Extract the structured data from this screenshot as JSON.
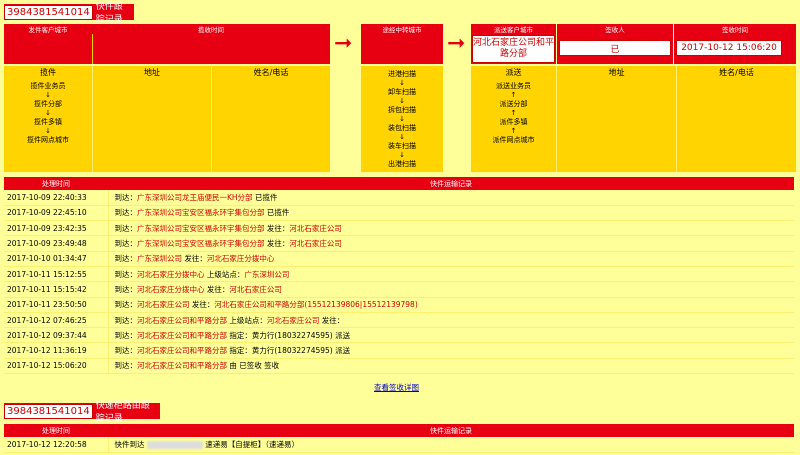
{
  "track": {
    "number": "3984381541014",
    "title": "快件跟踪记录",
    "col_origin_city": "发件客户城市",
    "col_collect_time": "揽收时间",
    "col_transit_city": "途经中转城市",
    "col_dest_city": "派送客户城市",
    "col_signer": "签收人",
    "col_sign_time": "签收时间",
    "dest_city_value": "河北石家庄公司和平路分部",
    "signer_value": "已",
    "sign_time_value": "2017-10-12 15:06:20",
    "sub_collect": "揽件",
    "sub_address": "地址",
    "sub_name_phone": "姓名/电话",
    "sub_deliver": "派送",
    "sub_address2": "地址",
    "sub_name_phone2": "姓名/电话",
    "collect_steps": [
      "揽件业务员",
      "揽件分部",
      "揽件多镇",
      "揽件网点城市"
    ],
    "transit_steps": [
      "进港扫描",
      "卸车扫描",
      "拆包扫描",
      "装包扫描",
      "装车扫描",
      "出港扫描"
    ],
    "deliver_steps": [
      "派送业务员",
      "派送分部",
      "派件多镇",
      "派件网点城市"
    ],
    "down_arrow": "↓",
    "up_arrow": "↑",
    "right_arrow": "➞"
  },
  "log": {
    "col_time": "处理时间",
    "col_record": "快件运输记录",
    "rows": [
      {
        "time": "2017-10-09 22:40:33",
        "pre": "到达：",
        "a": "广东深圳公司龙王庙便民一KH分部",
        "mid": " 已揽件",
        "b": "",
        "post": ""
      },
      {
        "time": "2017-10-09 22:45:10",
        "pre": "到达：",
        "a": "广东深圳公司宝安区福永环宇集包分部",
        "mid": " 已揽件",
        "b": "",
        "post": ""
      },
      {
        "time": "2017-10-09 23:42:35",
        "pre": "到达：",
        "a": "广东深圳公司宝安区福永环宇集包分部",
        "mid": " 发往：",
        "b": "河北石家庄公司",
        "post": ""
      },
      {
        "time": "2017-10-09 23:49:48",
        "pre": "到达：",
        "a": "广东深圳公司宝安区福永环宇集包分部",
        "mid": " 发往：",
        "b": "河北石家庄公司",
        "post": ""
      },
      {
        "time": "2017-10-10 01:34:47",
        "pre": "到达：",
        "a": "广东深圳公司",
        "mid": " 发往：",
        "b": "河北石家庄分拨中心",
        "post": ""
      },
      {
        "time": "2017-10-11 15:12:55",
        "pre": "到达：",
        "a": "河北石家庄分拨中心",
        "mid": " 上级站点：",
        "b": "广东深圳公司",
        "post": ""
      },
      {
        "time": "2017-10-11 15:15:42",
        "pre": "到达：",
        "a": "河北石家庄分拨中心",
        "mid": " 发往：",
        "b": "河北石家庄公司",
        "post": ""
      },
      {
        "time": "2017-10-11 23:50:50",
        "pre": "到达：",
        "a": "河北石家庄公司",
        "mid": " 发往：",
        "b": "河北石家庄公司和平路分部(15512139806|15512139798)",
        "post": ""
      },
      {
        "time": "2017-10-12 07:46:25",
        "pre": "到达：",
        "a": "河北石家庄公司和平路分部",
        "mid": " 上级站点：",
        "b": "河北石家庄公司",
        "post": " 发往："
      },
      {
        "time": "2017-10-12 09:37:44",
        "pre": "到达：",
        "a": "河北石家庄公司和平路分部",
        "mid": " 指定：黄力行(18032274595) 派送",
        "b": "",
        "post": ""
      },
      {
        "time": "2017-10-12 11:36:19",
        "pre": "到达：",
        "a": "河北石家庄公司和平路分部",
        "mid": " 指定：黄力行(18032274595) 派送",
        "b": "",
        "post": ""
      },
      {
        "time": "2017-10-12 15:06:20",
        "pre": "到达：",
        "a": "河北石家庄公司和平路分部",
        "mid": " 由 已签收 签收",
        "b": "",
        "post": ""
      }
    ],
    "view_sign_link": "查看签收详图"
  },
  "route": {
    "number": "3984381541014",
    "title": "快递柜路由跟踪记录",
    "col_time": "处理时间",
    "col_record": "快件运输记录",
    "row_time": "2017-10-12 12:20:58",
    "row_pre": "快件到达",
    "row_post": "速递易【自提柜】（速递易）"
  }
}
